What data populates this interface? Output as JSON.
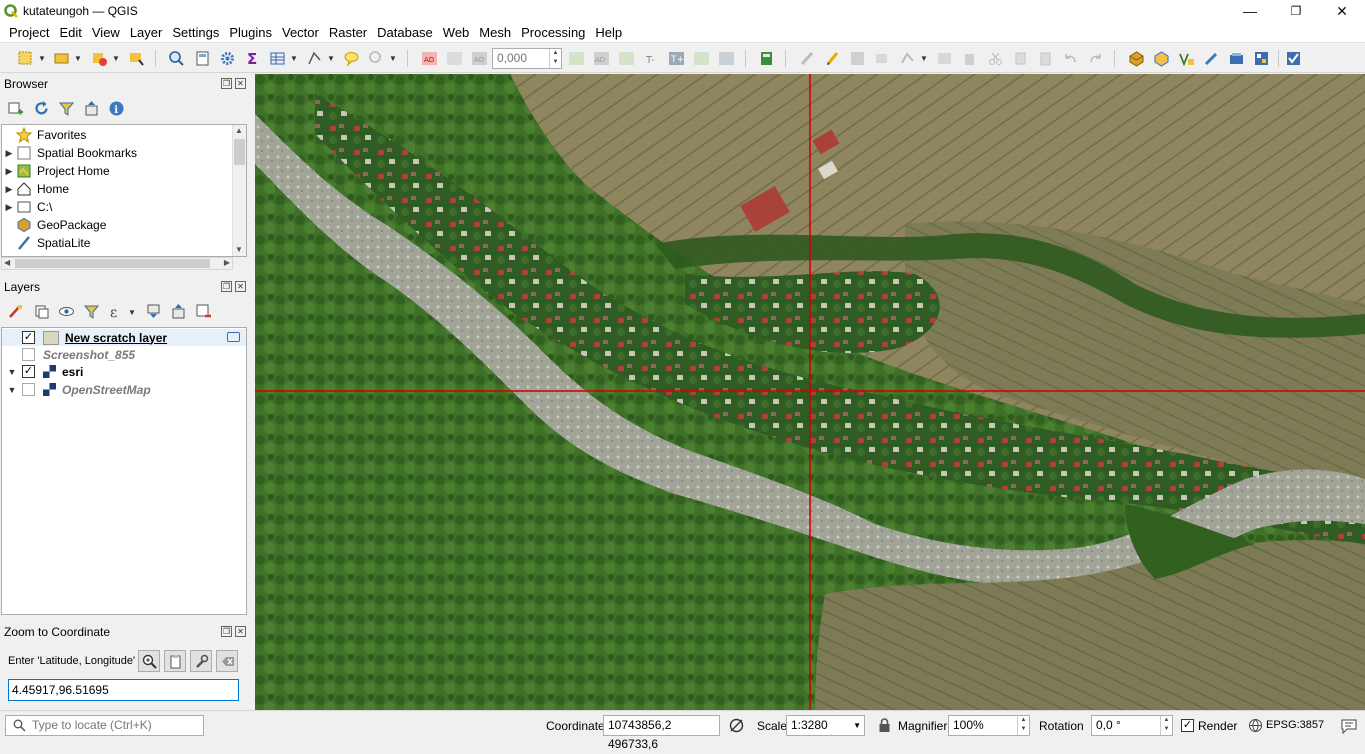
{
  "window": {
    "title": "kutateungoh — QGIS",
    "controls": [
      "minimize",
      "maximize",
      "close"
    ]
  },
  "menu": [
    "Project",
    "Edit",
    "View",
    "Layer",
    "Settings",
    "Plugins",
    "Vector",
    "Raster",
    "Database",
    "Web",
    "Mesh",
    "Processing",
    "Help"
  ],
  "toolbar": {
    "rotation_value": "0,000"
  },
  "browser": {
    "title": "Browser",
    "items": [
      {
        "label": "Favorites",
        "icon": "star-icon",
        "expandable": false
      },
      {
        "label": "Spatial Bookmarks",
        "icon": "bookmark-icon",
        "expandable": true
      },
      {
        "label": "Project Home",
        "icon": "project-home-icon",
        "expandable": true
      },
      {
        "label": "Home",
        "icon": "home-icon",
        "expandable": true
      },
      {
        "label": "C:\\",
        "icon": "folder-icon",
        "expandable": true
      },
      {
        "label": "GeoPackage",
        "icon": "geopackage-icon",
        "expandable": false
      },
      {
        "label": "SpatiaLite",
        "icon": "spatialite-icon",
        "expandable": false
      }
    ]
  },
  "layers": {
    "title": "Layers",
    "items": [
      {
        "label": "New scratch layer",
        "checked": true,
        "style": "bold-underline",
        "expandable": false
      },
      {
        "label": "Screenshot_855",
        "checked": false,
        "style": "italic-gray",
        "expandable": false
      },
      {
        "label": "esri",
        "checked": true,
        "style": "bold",
        "expandable": true
      },
      {
        "label": "OpenStreetMap",
        "checked": false,
        "style": "italic-gray",
        "expandable": true
      }
    ]
  },
  "zoom_to_coordinate": {
    "title": "Zoom to Coordinate",
    "prompt": "Enter 'Latitude, Longitude'",
    "value": "4.45917,96.51695"
  },
  "status": {
    "locator_placeholder": "Type to locate (Ctrl+K)",
    "coordinate_label": "Coordinate",
    "coordinate_value": "10743856,2 496733,6",
    "scale_label": "Scale",
    "scale_value": "1:3280",
    "magnifier_label": "Magnifier",
    "magnifier_value": "100%",
    "rotation_label": "Rotation",
    "rotation_value": "0,0 °",
    "render_label": "Render",
    "render_checked": true,
    "crs": "EPSG:3857"
  },
  "colors": {
    "crosshair": "#d40000",
    "forest": "#3f7028",
    "river": "#9a9e92",
    "fields": "#8e845e",
    "village_trees": "#2f5b20",
    "roofs": "#a9433a"
  }
}
